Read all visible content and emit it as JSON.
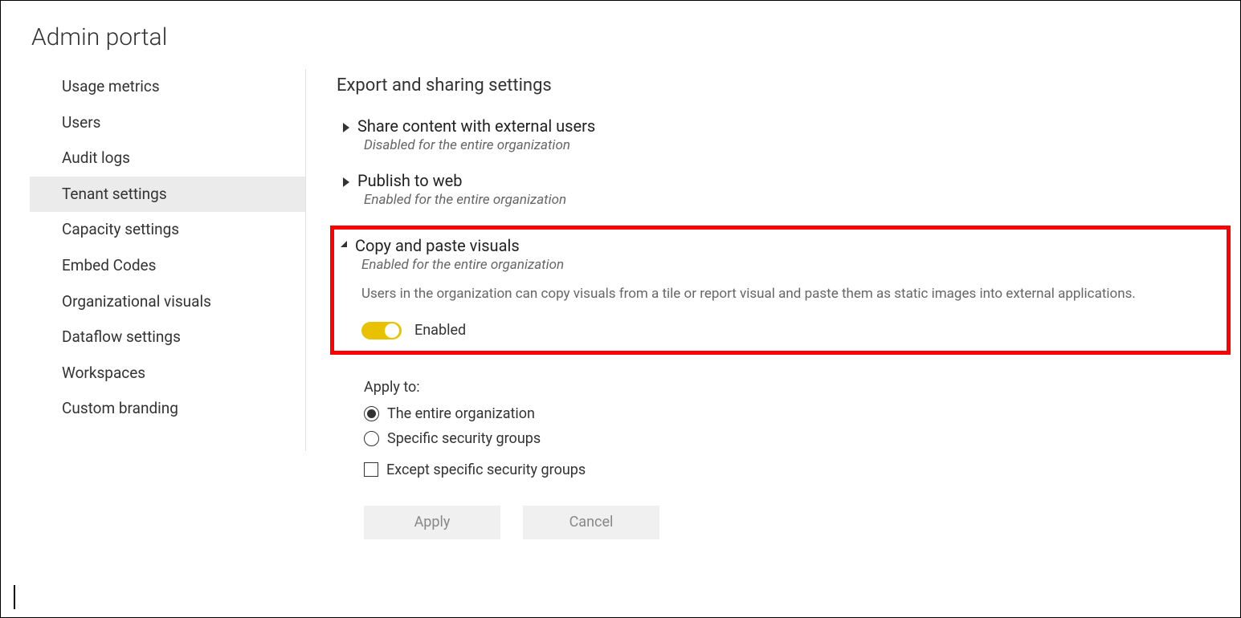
{
  "page_title": "Admin portal",
  "sidebar": {
    "items": [
      {
        "label": "Usage metrics"
      },
      {
        "label": "Users"
      },
      {
        "label": "Audit logs"
      },
      {
        "label": "Tenant settings"
      },
      {
        "label": "Capacity settings"
      },
      {
        "label": "Embed Codes"
      },
      {
        "label": "Organizational visuals"
      },
      {
        "label": "Dataflow settings"
      },
      {
        "label": "Workspaces"
      },
      {
        "label": "Custom branding"
      }
    ],
    "selected_index": 3
  },
  "section": {
    "title": "Export and sharing settings",
    "settings": [
      {
        "title": "Share content with external users",
        "status": "Disabled for the entire organization"
      },
      {
        "title": "Publish to web",
        "status": "Enabled for the entire organization"
      },
      {
        "title": "Copy and paste visuals",
        "status": "Enabled for the entire organization",
        "description": "Users in the organization can copy visuals from a tile or report visual and paste them as static images into external applications.",
        "toggle_label": "Enabled"
      }
    ]
  },
  "apply_to": {
    "label": "Apply to:",
    "options": {
      "entire_org": "The entire organization",
      "specific_groups": "Specific security groups"
    },
    "except_label": "Except specific security groups"
  },
  "buttons": {
    "apply": "Apply",
    "cancel": "Cancel"
  }
}
